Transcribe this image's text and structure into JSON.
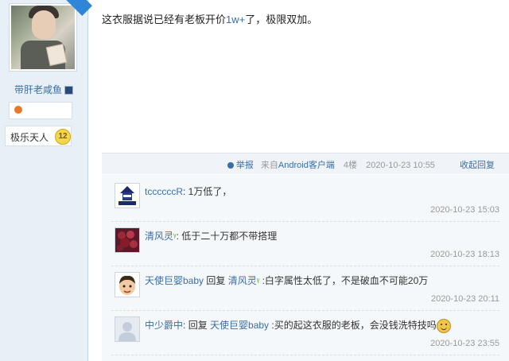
{
  "author": {
    "username": "带肝老咸鱼",
    "group": "极乐天人",
    "level": "12"
  },
  "post": {
    "text_before": "这衣服据说已经有老板开价",
    "text_highlight": "1w+",
    "text_after": "了，极限双加。"
  },
  "footer": {
    "report_label": "举报",
    "source_prefix": "来自",
    "source_client": "Android客户端",
    "floor": "4楼",
    "timestamp": "2020-10-23 10:55",
    "collapse_label": "收起回复"
  },
  "comments": [
    {
      "name": "tccccccR",
      "sep": ":",
      "text": " 1万低了，",
      "time": "2020-10-23 15:03"
    },
    {
      "name": "清风灵",
      "badge": "sprout-icon",
      "sep": ":",
      "text": " 低于二十万都不带搭理",
      "time": "2020-10-23 18:13"
    },
    {
      "name": "天使巨婴baby",
      "sep": ":",
      "reply_label": " 回复 ",
      "reply_to": "清风灵",
      "text": " :白字属性太低了，不是破血不可能20万",
      "time": "2020-10-23 20:11"
    },
    {
      "name": "中少爵中",
      "sep": ":",
      "reply_label": " 回复 ",
      "reply_to": "天使巨婴baby",
      "text": " :买的起这衣服的老板，会没钱洗特技吗",
      "time": "2020-10-23 23:55"
    }
  ],
  "colors": {
    "link": "#3a6ea5",
    "sidebar_bg": "#e8f0f7",
    "comment_bg": "#f5f8fa"
  }
}
